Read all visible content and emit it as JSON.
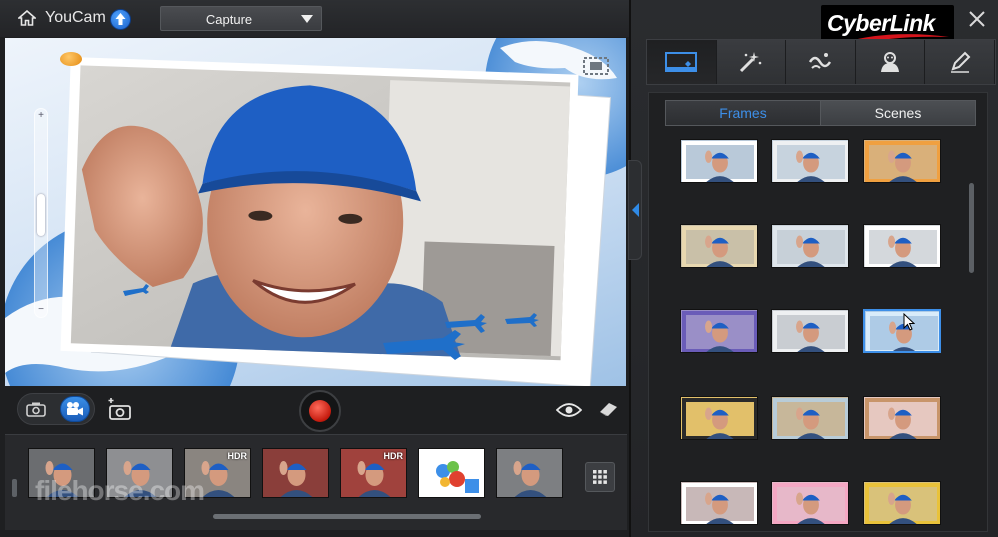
{
  "app": {
    "title": "YouCam",
    "brand": "CyberLink"
  },
  "header": {
    "mode_select_value": "Capture"
  },
  "panel": {
    "tabs": [
      "frames-tab",
      "effects-tab",
      "particles-tab",
      "avatar-tab",
      "draw-tab"
    ],
    "segments": {
      "frames": "Frames",
      "scenes": "Scenes"
    }
  },
  "strip": {
    "watermark": "filehorse.com",
    "items": [
      {
        "kind": "photo",
        "hdr": ""
      },
      {
        "kind": "photo",
        "hdr": ""
      },
      {
        "kind": "photo",
        "hdr": "HDR"
      },
      {
        "kind": "photo",
        "hdr": ""
      },
      {
        "kind": "photo",
        "hdr": "HDR"
      },
      {
        "kind": "video",
        "hdr": ""
      },
      {
        "kind": "photo",
        "hdr": ""
      }
    ]
  },
  "frames": {
    "selected_index": 8,
    "count": 15
  },
  "colors": {
    "accent": "#3d8fe8",
    "record": "#d3251a",
    "panel": "#232427"
  }
}
